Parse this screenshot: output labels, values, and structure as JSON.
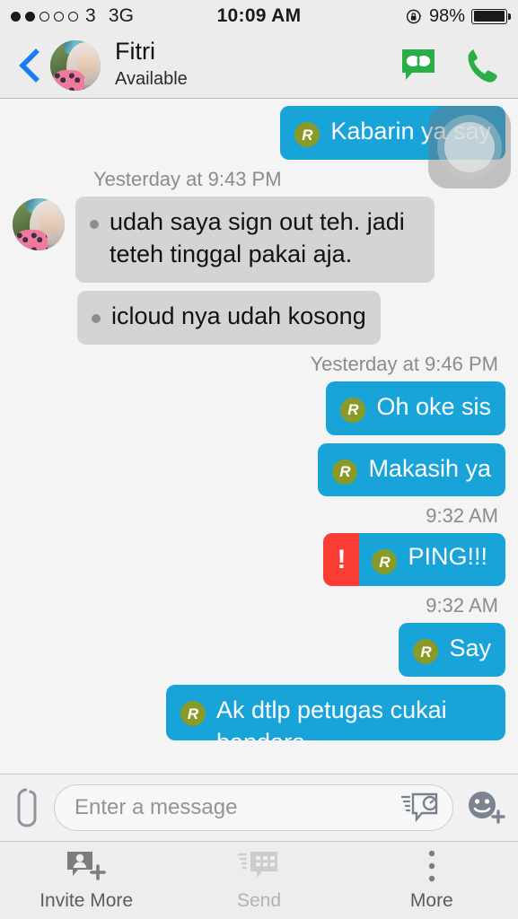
{
  "status_bar": {
    "signal_filled": 2,
    "signal_total": 5,
    "carrier": "3",
    "network": "3G",
    "time": "10:09 AM",
    "battery_percent": "98%",
    "rotation_lock_icon": "rotation-lock-icon"
  },
  "header": {
    "back_icon": "back-chevron-icon",
    "contact_name": "Fitri",
    "contact_status": "Available",
    "video_chat_icon": "bbm-video-icon",
    "call_icon": "phone-call-icon",
    "accent_green": "#2aae46",
    "accent_blue": "#1a7cf5"
  },
  "chat": {
    "bubble_out_color": "#18a3d9",
    "bubble_in_color": "#d4d4d4",
    "read_badge_color": "#8a9a26",
    "ping_alert_color": "#f93c34",
    "read_badge_letter": "R",
    "messages": [
      {
        "id": "m1",
        "direction": "out",
        "text": "Kabarin ya say",
        "badge": "R",
        "timestamp": null
      },
      {
        "id": "m2",
        "direction": "in",
        "timestamp": "Yesterday at 9:43 PM",
        "text": "udah saya sign out teh. jadi teteh tinggal pakai aja.",
        "bulleted": true,
        "show_avatar": true
      },
      {
        "id": "m3",
        "direction": "in",
        "timestamp": null,
        "text": "icloud nya udah kosong",
        "bulleted": true,
        "show_avatar": false
      },
      {
        "id": "m4",
        "direction": "out",
        "timestamp": "Yesterday at 9:46 PM",
        "text": "Oh oke sis",
        "badge": "R"
      },
      {
        "id": "m5",
        "direction": "out",
        "timestamp": null,
        "text": "Makasih ya",
        "badge": "R"
      },
      {
        "id": "m6",
        "direction": "out",
        "timestamp": "9:32 AM",
        "text": "PING!!!",
        "badge": "R",
        "alert": "!",
        "is_ping": true
      },
      {
        "id": "m7",
        "direction": "out",
        "timestamp": "9:32 AM",
        "text": "Say",
        "badge": "R"
      },
      {
        "id": "m8",
        "direction": "out",
        "timestamp": null,
        "text": "Ak dtlp petugas cukai bandara",
        "badge": "R",
        "clipped": true
      }
    ],
    "assistive_touch_overlay": "assistive-touch-button"
  },
  "input_bar": {
    "attach_icon": "paperclip-icon",
    "placeholder": "Enter a message",
    "value": "",
    "timed_message_icon": "timed-message-icon",
    "emoji_icon": "emoji-add-icon"
  },
  "toolbar": {
    "items": [
      {
        "id": "invite",
        "label": "Invite More",
        "icon": "invite-contact-icon",
        "disabled": false
      },
      {
        "id": "send",
        "label": "Send",
        "icon": "bbm-send-icon",
        "disabled": true
      },
      {
        "id": "more",
        "label": "More",
        "icon": "more-vertical-icon",
        "disabled": false
      }
    ]
  }
}
